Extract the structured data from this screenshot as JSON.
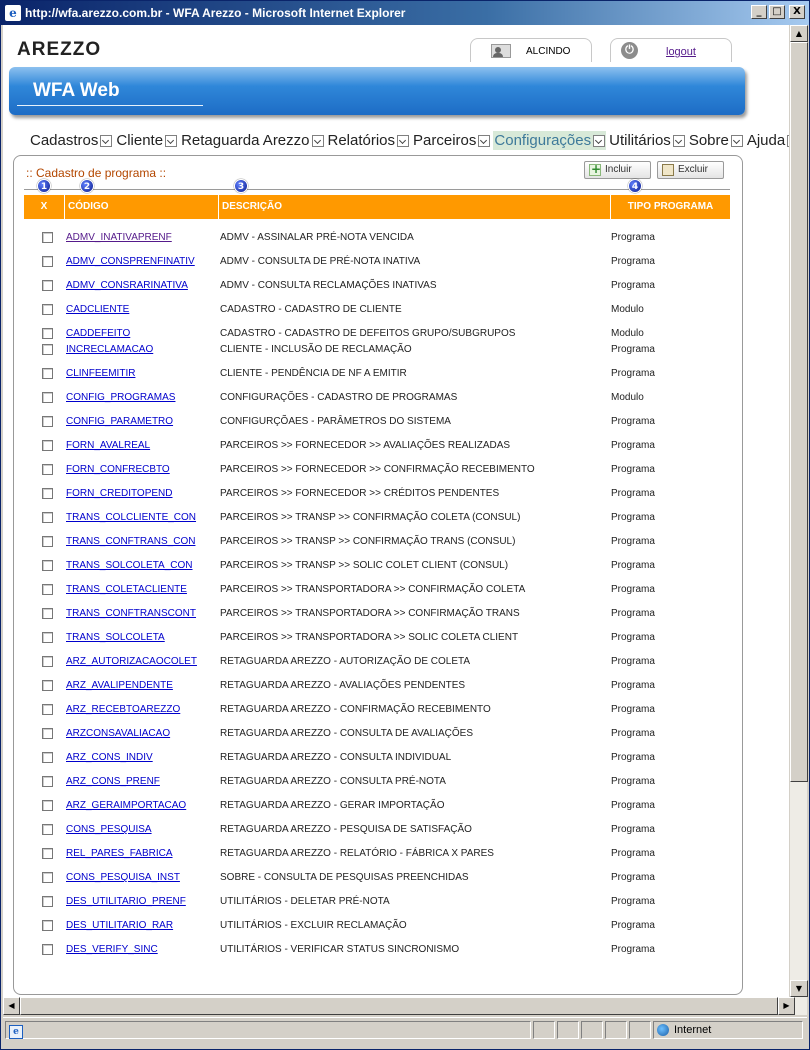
{
  "window": {
    "title": "http://wfa.arezzo.com.br - WFA Arezzo - Microsoft Internet Explorer",
    "minimize": "_",
    "maximize": "□",
    "close": "X"
  },
  "header": {
    "logo": "AREZZO",
    "user_name": "ALCINDO",
    "logout_label": "logout",
    "banner_title": "WFA Web"
  },
  "menu": [
    {
      "label": "Cadastros",
      "active": false
    },
    {
      "label": "Cliente",
      "active": false
    },
    {
      "label": "Retaguarda Arezzo",
      "active": false
    },
    {
      "label": "Relatórios",
      "active": false
    },
    {
      "label": "Parceiros",
      "active": false
    },
    {
      "label": "Configurações",
      "active": true
    },
    {
      "label": "Utilitários",
      "active": false
    },
    {
      "label": "Sobre",
      "active": false
    },
    {
      "label": "Ajuda",
      "active": false
    }
  ],
  "panel": {
    "title": ":: Cadastro de programa ::",
    "incluir_label": "Incluir",
    "excluir_label": "Excluir",
    "columns": {
      "x": "X",
      "codigo": "CÓDIGO",
      "descricao": "DESCRIÇÃO",
      "tipo": "TIPO PROGRAMA"
    },
    "markers": [
      "1",
      "2",
      "3",
      "4"
    ]
  },
  "rows": [
    {
      "code": "ADMV_INATIVAPRENF",
      "desc": "ADMV - ASSINALAR PRÉ-NOTA VENCIDA",
      "tipo": "Programa",
      "visited": true
    },
    {
      "code": "ADMV_CONSPRENFINATIV",
      "desc": "ADMV - CONSULTA DE PRÉ-NOTA INATIVA",
      "tipo": "Programa",
      "visited": false
    },
    {
      "code": "ADMV_CONSRARINATIVA",
      "desc": "ADMV - CONSULTA RECLAMAÇÕES INATIVAS",
      "tipo": "Programa",
      "visited": false
    },
    {
      "code": "CADCLIENTE",
      "desc": "CADASTRO - CADASTRO DE CLIENTE",
      "tipo": "Modulo",
      "visited": false
    },
    {
      "code": "CADDEFEITO",
      "desc": "CADASTRO - CADASTRO DE DEFEITOS GRUPO/SUBGRUPOS",
      "tipo": "Modulo",
      "visited": false
    },
    {
      "code": "INCRECLAMACAO",
      "desc": "CLIENTE - INCLUSÃO DE RECLAMAÇÃO",
      "tipo": "Programa",
      "visited": false
    },
    {
      "code": "CLINFEEMITIR",
      "desc": "CLIENTE - PENDÊNCIA DE NF A EMITIR",
      "tipo": "Programa",
      "visited": false
    },
    {
      "code": "CONFIG_PROGRAMAS",
      "desc": "CONFIGURAÇÕES - CADASTRO DE PROGRAMAS",
      "tipo": "Modulo",
      "visited": false
    },
    {
      "code": "CONFIG_PARAMETRO",
      "desc": "CONFIGURÇÕAES - PARÂMETROS DO SISTEMA",
      "tipo": "Programa",
      "visited": false
    },
    {
      "code": "FORN_AVALREAL",
      "desc": "PARCEIROS >> FORNECEDOR >> AVALIAÇÕES REALIZADAS",
      "tipo": "Programa",
      "visited": false
    },
    {
      "code": "FORN_CONFRECBTO",
      "desc": "PARCEIROS >> FORNECEDOR >> CONFIRMAÇÃO RECEBIMENTO",
      "tipo": "Programa",
      "visited": false
    },
    {
      "code": "FORN_CREDITOPEND",
      "desc": "PARCEIROS >> FORNECEDOR >> CRÉDITOS PENDENTES",
      "tipo": "Programa",
      "visited": false
    },
    {
      "code": "TRANS_COLCLIENTE_CON",
      "desc": "PARCEIROS >> TRANSP >> CONFIRMAÇÃO COLETA (CONSUL)",
      "tipo": "Programa",
      "visited": false
    },
    {
      "code": "TRANS_CONFTRANS_CON",
      "desc": "PARCEIROS >> TRANSP >> CONFIRMAÇÃO TRANS (CONSUL)",
      "tipo": "Programa",
      "visited": false
    },
    {
      "code": "TRANS_SOLCOLETA_CON",
      "desc": "PARCEIROS >> TRANSP >> SOLIC COLET CLIENT (CONSUL)",
      "tipo": "Programa",
      "visited": false
    },
    {
      "code": "TRANS_COLETACLIENTE",
      "desc": "PARCEIROS >> TRANSPORTADORA >> CONFIRMAÇÃO COLETA",
      "tipo": "Programa",
      "visited": false
    },
    {
      "code": "TRANS_CONFTRANSCONT",
      "desc": "PARCEIROS >> TRANSPORTADORA >> CONFIRMAÇÃO TRANS",
      "tipo": "Programa",
      "visited": false
    },
    {
      "code": "TRANS_SOLCOLETA",
      "desc": "PARCEIROS >> TRANSPORTADORA >> SOLIC COLETA CLIENT",
      "tipo": "Programa",
      "visited": false
    },
    {
      "code": "ARZ_AUTORIZACAOCOLET",
      "desc": "RETAGUARDA AREZZO - AUTORIZAÇÃO DE COLETA",
      "tipo": "Programa",
      "visited": false
    },
    {
      "code": "ARZ_AVALIPENDENTE",
      "desc": "RETAGUARDA AREZZO - AVALIAÇÕES PENDENTES",
      "tipo": "Programa",
      "visited": false
    },
    {
      "code": "ARZ_RECEBTOAREZZO",
      "desc": "RETAGUARDA AREZZO - CONFIRMAÇÃO RECEBIMENTO",
      "tipo": "Programa",
      "visited": false
    },
    {
      "code": "ARZCONSAVALIACAO",
      "desc": "RETAGUARDA AREZZO - CONSULTA DE AVALIAÇÕES",
      "tipo": "Programa",
      "visited": false
    },
    {
      "code": "ARZ_CONS_INDIV",
      "desc": "RETAGUARDA AREZZO - CONSULTA INDIVIDUAL",
      "tipo": "Programa",
      "visited": false
    },
    {
      "code": "ARZ_CONS_PRENF",
      "desc": "RETAGUARDA AREZZO - CONSULTA PRÉ-NOTA",
      "tipo": "Programa",
      "visited": false
    },
    {
      "code": "ARZ_GERAIMPORTACAO",
      "desc": "RETAGUARDA AREZZO - GERAR IMPORTAÇÃO",
      "tipo": "Programa",
      "visited": false
    },
    {
      "code": "CONS_PESQUISA",
      "desc": "RETAGUARDA AREZZO - PESQUISA DE SATISFAÇÃO",
      "tipo": "Programa",
      "visited": false
    },
    {
      "code": "REL_PARES_FABRICA",
      "desc": "RETAGUARDA AREZZO - RELATÓRIO - FÁBRICA X PARES",
      "tipo": "Programa",
      "visited": false
    },
    {
      "code": "CONS_PESQUISA_INST",
      "desc": "SOBRE - CONSULTA DE PESQUISAS PREENCHIDAS",
      "tipo": "Programa",
      "visited": false
    },
    {
      "code": "DES_UTILITARIO_PRENF",
      "desc": "UTILITÁRIOS - DELETAR PRÉ-NOTA",
      "tipo": "Programa",
      "visited": false
    },
    {
      "code": "DES_UTILITARIO_RAR",
      "desc": "UTILITÁRIOS - EXCLUIR RECLAMAÇÃO",
      "tipo": "Programa",
      "visited": false
    },
    {
      "code": "DES_VERIFY_SINC",
      "desc": "UTILITÁRIOS - VERIFICAR STATUS SINCRONISMO",
      "tipo": "Programa",
      "visited": false
    }
  ],
  "status": {
    "zone": "Internet"
  }
}
